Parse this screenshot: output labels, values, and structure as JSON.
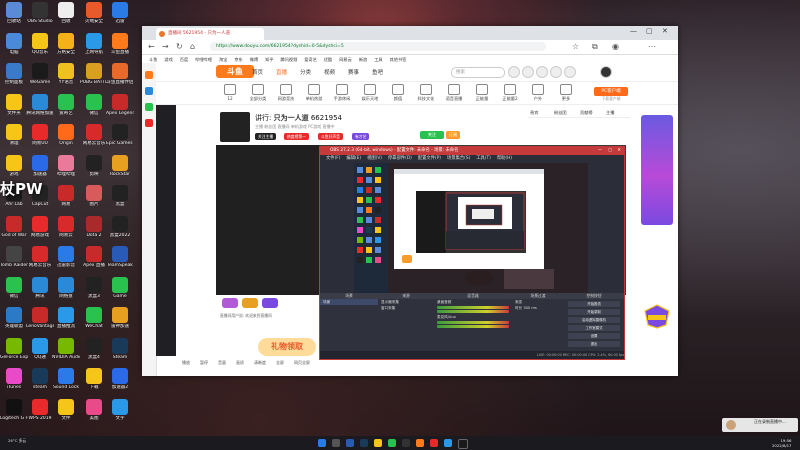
{
  "desktop": {
    "icons": [
      {
        "label": "回收站",
        "color": "#5a8ad8"
      },
      {
        "label": "OBS Studio",
        "color": "#333"
      },
      {
        "label": "回收",
        "color": "#eee"
      },
      {
        "label": "火绒安全",
        "color": "#e85a2a"
      },
      {
        "label": "迅雷",
        "color": "#2a7ae8"
      },
      {
        "label": "电脑",
        "color": "#4a8ad8"
      },
      {
        "label": "QQ音乐",
        "color": "#f5c518"
      },
      {
        "label": "方格安全",
        "color": "#f5b01a"
      },
      {
        "label": "上网导航",
        "color": "#2a9ae8"
      },
      {
        "label": "斗鱼直播",
        "color": "#ff7a1a"
      },
      {
        "label": "控制面板",
        "color": "#3a7ac8"
      },
      {
        "label": "WeGame",
        "color": "#1a1a1a"
      },
      {
        "label": "YY语音",
        "color": "#f0c020"
      },
      {
        "label": "PUBG BATTLEGR...",
        "color": "#d8a020"
      },
      {
        "label": "斗鱼直播伴侣",
        "color": "#e86a2a"
      },
      {
        "label": "文件夹",
        "color": "#f5c518"
      },
      {
        "label": "腾讯网络加速",
        "color": "#2a8ad8"
      },
      {
        "label": "爱奇艺",
        "color": "#2ac24e"
      },
      {
        "label": "微信",
        "color": "#2ac24e"
      },
      {
        "label": "Apex Legends",
        "color": "#c82a2a"
      },
      {
        "label": "清理",
        "color": "#f5c518"
      },
      {
        "label": "网易UU",
        "color": "#e82a2a"
      },
      {
        "label": "Origin",
        "color": "#ff6a1a"
      },
      {
        "label": "网易云音乐",
        "color": "#d82a2a"
      },
      {
        "label": "Epic Games Launcher",
        "color": "#222"
      },
      {
        "label": "游戏",
        "color": "#f5c518"
      },
      {
        "label": "加速器",
        "color": "#2a6ae8"
      },
      {
        "label": "哔哩哔哩",
        "color": "#ea7a9a"
      },
      {
        "label": "剪映",
        "color": "#222"
      },
      {
        "label": "RockStar",
        "color": "#e8a020"
      },
      {
        "label": "Ahr Lab",
        "color": "#1a1a1a"
      },
      {
        "label": "CapCut",
        "color": "#222"
      },
      {
        "label": "网易",
        "color": "#c82a2a"
      },
      {
        "label": "图片",
        "color": "#d85a5a"
      },
      {
        "label": "黑盒",
        "color": "#222"
      },
      {
        "label": "God of War",
        "color": "#c82a2a"
      },
      {
        "label": "网易游戏",
        "color": "#e82a2a"
      },
      {
        "label": "网易云",
        "color": "#d82a2a"
      },
      {
        "label": "Dota 2",
        "color": "#a82a2a"
      },
      {
        "label": "黑盒2022",
        "color": "#222"
      },
      {
        "label": "Tomb Raider",
        "color": "#444"
      },
      {
        "label": "网易云音乐",
        "color": "#d82a2a"
      },
      {
        "label": "迅雷影音",
        "color": "#2a7ae8"
      },
      {
        "label": "Apex 直播",
        "color": "#c82a2a"
      },
      {
        "label": "TeamSpeak",
        "color": "#2a5ab8"
      },
      {
        "label": "微信",
        "color": "#2ac24e"
      },
      {
        "label": "腾讯",
        "color": "#2a8ad8"
      },
      {
        "label": "网络盘",
        "color": "#2a8ad8"
      },
      {
        "label": "黑盒3",
        "color": "#222"
      },
      {
        "label": "Game",
        "color": "#2ac24e"
      },
      {
        "label": "英雄联盟",
        "color": "#2a7ac8"
      },
      {
        "label": "LenoVantage",
        "color": "#c82a2a"
      },
      {
        "label": "直播推流",
        "color": "#2a9ae8"
      },
      {
        "label": "WeChat",
        "color": "#2ac24e"
      },
      {
        "label": "雷神加速",
        "color": "#e8a020"
      },
      {
        "label": "GeForce Experience",
        "color": "#76b900"
      },
      {
        "label": "QQ通",
        "color": "#2a9ae8"
      },
      {
        "label": "NVIDIA Audio",
        "color": "#76b900"
      },
      {
        "label": "黑盒4",
        "color": "#222"
      },
      {
        "label": "Steam",
        "color": "#1a3a5a"
      },
      {
        "label": "iTunes",
        "color": "#e84ac8"
      },
      {
        "label": "steam",
        "color": "#1a3a5a"
      },
      {
        "label": "Sound Lock",
        "color": "#2a7ae8"
      },
      {
        "label": "下载",
        "color": "#f5c518"
      },
      {
        "label": "加速器2",
        "color": "#2a6ae8"
      },
      {
        "label": "Logitech G HUB",
        "color": "#111"
      },
      {
        "label": "WPS 2019",
        "color": "#e82a2a"
      },
      {
        "label": "文件",
        "color": "#f5c518"
      },
      {
        "label": "美图",
        "color": "#e84a8a"
      },
      {
        "label": "文字",
        "color": "#2a9ae8"
      }
    ],
    "watermark": "杖PW"
  },
  "browser": {
    "tab_label": "直播间 5621954 - 只为一人道",
    "url": "https://www.douyu.com/6621954?dyshid=0-5&dyshci=5",
    "bookmarks": [
      "斗鱼",
      "游戏",
      "百度",
      "哔哩哔哩",
      "淘宝",
      "京东",
      "微博",
      "知乎",
      "腾讯视频",
      "爱奇艺",
      "优酷",
      "网易云",
      "新浪",
      "工具",
      "其他书签"
    ]
  },
  "douyu": {
    "logo": "斗鱼",
    "nav": [
      "首页",
      "直播",
      "分类",
      "视频",
      "赛事",
      "鱼吧"
    ],
    "search_placeholder": "搜索",
    "categories": [
      {
        "label": "12"
      },
      {
        "label": "全部分类"
      },
      {
        "label": "网游竞技"
      },
      {
        "label": "单机热游"
      },
      {
        "label": "手游休闲"
      },
      {
        "label": "娱乐天地"
      },
      {
        "label": "颜值"
      },
      {
        "label": "科技文化"
      },
      {
        "label": "语音直播"
      },
      {
        "label": "正能量"
      },
      {
        "label": "正能量2"
      },
      {
        "label": "户外"
      },
      {
        "label": "更多"
      }
    ],
    "pc_client": "PC客户端",
    "pc_client_sub": "下载客户端",
    "room_title": "只为一人道",
    "room_prefix": "讲行:",
    "room_id": "6621954",
    "room_sub": "主播  粉丝团  直播间  单机游戏  PC游戏  直播中",
    "tags": [
      "关注主播",
      "热度榜第一",
      "斗鱼好声音",
      "有才艺"
    ],
    "follow": "关注",
    "subscribe": "订阅",
    "right_tabs": [
      "贵宾",
      "粉丝团",
      "贡献榜",
      "主播"
    ],
    "gift_text": "礼物领取",
    "below_text": "直播间用户说: 欢迎来到直播间",
    "bottom_controls": [
      "播放",
      "暂停",
      "音量",
      "画质",
      "清晰度",
      "全屏",
      "网页全屏"
    ]
  },
  "obs": {
    "title": "OBS 27.2.3 (64-bit, windows) - 配置文件: 未命名 - 场景: 未命名",
    "menu": [
      "文件(F)",
      "编辑(E)",
      "视图(V)",
      "停靠部件(D)",
      "配置文件(P)",
      "场景集合(S)",
      "工具(T)",
      "帮助(H)"
    ],
    "docks": {
      "scenes": {
        "title": "场景",
        "items": [
          "场景"
        ]
      },
      "sources": {
        "title": "来源",
        "items": [
          "显示器采集",
          "窗口采集"
        ]
      },
      "mixer": {
        "title": "混音器",
        "items": [
          "桌面音频",
          "麦克风/Aux"
        ]
      },
      "transitions": {
        "title": "场景过渡",
        "items": [
          "渐变",
          "时长 300 ms"
        ]
      },
      "controls": {
        "title": "控制按钮",
        "items": [
          "开始推流",
          "开始录制",
          "启动虚拟摄像机",
          "工作室模式",
          "设置",
          "退出"
        ]
      }
    },
    "status": "LIVE: 00:00:00   REC: 00:00:00   CPU: 2.4%, 60.00 fps"
  },
  "taskbar": {
    "weather": "26°C 多云",
    "time": "19:56",
    "date": "2022/8/17"
  },
  "notification": "正在录制直播中..."
}
